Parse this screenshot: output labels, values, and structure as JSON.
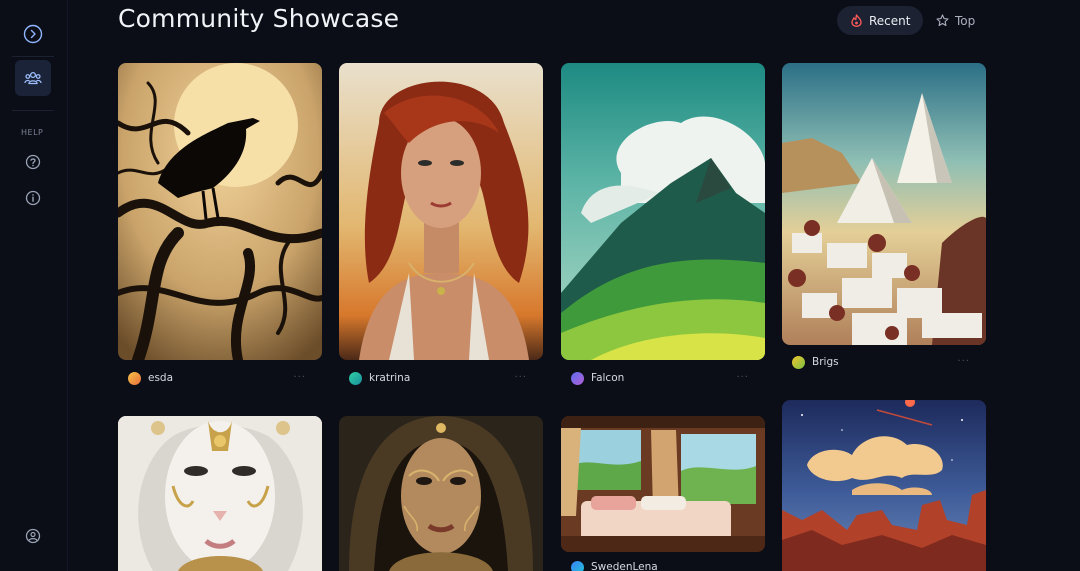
{
  "sidebar": {
    "help_label": "HELP",
    "icons": [
      "chevron-right-circle-icon",
      "community-icon",
      "question-circle-icon",
      "info-circle-icon",
      "user-circle-icon"
    ]
  },
  "header": {
    "title": "Community Showcase",
    "tabs": [
      {
        "label": "Recent",
        "icon": "flame-icon",
        "active": true
      },
      {
        "label": "Top",
        "icon": "star-icon",
        "active": false
      }
    ]
  },
  "colors": {
    "background": "#0b0e17",
    "sidebar_active": "#1a2338",
    "tab_active": "#1c2232"
  },
  "cards": [
    {
      "user": "esda",
      "avatar_color": "#f0a53a",
      "image": "raven on tree against moon"
    },
    {
      "user": "kratrina",
      "avatar_color": "#2ec4a0",
      "image": "red-haired woman portrait"
    },
    {
      "user": "Falcon",
      "avatar_color": "#8a63d2",
      "image": "green mountain landscape"
    },
    {
      "user": "Brigs",
      "avatar_color": "#e0b528",
      "image": "white pyramids and village"
    },
    {
      "user": "",
      "avatar_color": "#cccccc",
      "image": "white masked face"
    },
    {
      "user": "",
      "avatar_color": "#cccccc",
      "image": "golden hooded woman"
    },
    {
      "user": "SwedenLena",
      "avatar_color": "#3b82f6",
      "image": "cozy bedroom interior"
    },
    {
      "user": "",
      "avatar_color": "#cccccc",
      "image": "red canyon with clouds"
    }
  ]
}
